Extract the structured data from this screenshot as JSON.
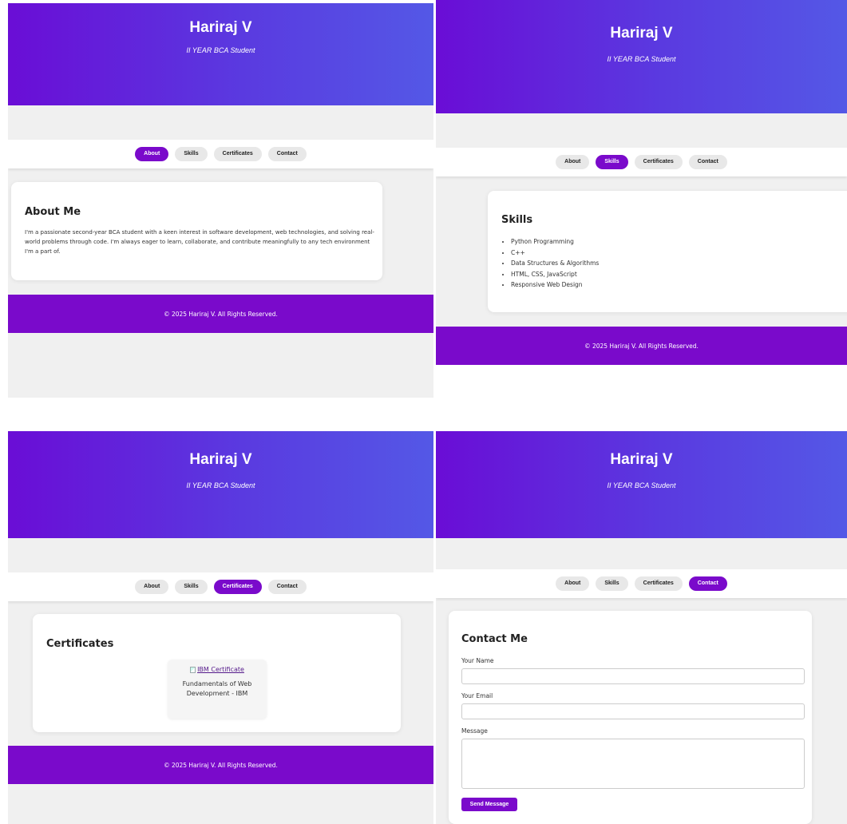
{
  "site": {
    "name": "Hariraj V",
    "tagline": "II YEAR BCA Student",
    "footer": "© 2025 Hariraj V. All Rights Reserved."
  },
  "nav": {
    "about": "About",
    "skills": "Skills",
    "certificates": "Certificates",
    "contact": "Contact"
  },
  "about": {
    "title": "About Me",
    "body": "I'm a passionate second-year BCA student with a keen interest in software development, web technologies, and solving real-world problems through code. I'm always eager to learn, collaborate, and contribute meaningfully to any tech environment I'm a part of."
  },
  "skills": {
    "title": "Skills",
    "items": [
      "Python Programming",
      "C++",
      "Data Structures & Algorithms",
      "HTML, CSS, JavaScript",
      "Responsive Web Design"
    ]
  },
  "certificates": {
    "title": "Certificates",
    "items": [
      {
        "image_alt": "IBM Certificate",
        "caption": "Fundamentals of Web Development - IBM"
      }
    ]
  },
  "contact": {
    "title": "Contact Me",
    "name_label": "Your Name",
    "email_label": "Your Email",
    "message_label": "Message",
    "name_value": "",
    "email_value": "",
    "message_value": "",
    "send_label": "Send Message"
  },
  "active_tabs": [
    "About",
    "Skills",
    "Certificates",
    "Contact"
  ],
  "colors": {
    "hero_start": "#6a0dd6",
    "hero_end": "#5458e6",
    "accent": "#7a0acb",
    "background": "#f0f0f0"
  }
}
